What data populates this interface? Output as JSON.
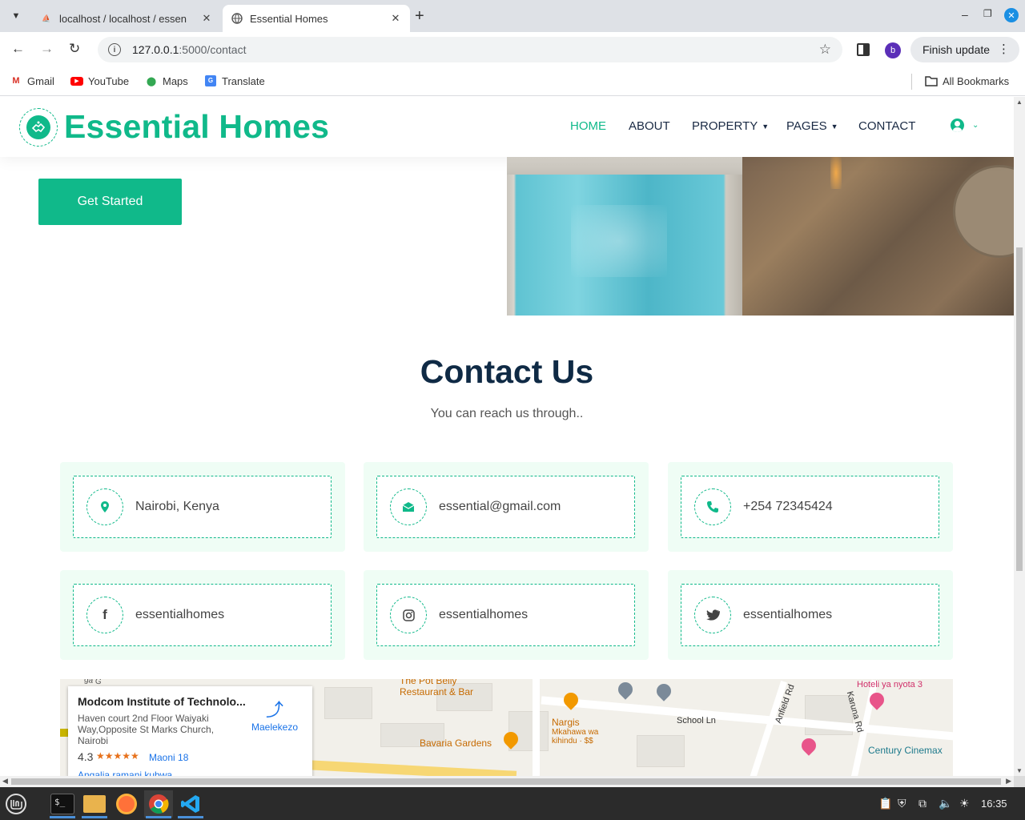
{
  "browser": {
    "tabs": [
      {
        "title": "localhost / localhost / essen",
        "favicon": "phpmyadmin-icon",
        "active": false
      },
      {
        "title": "Essential Homes",
        "favicon": "globe-icon",
        "active": true
      }
    ],
    "url_host": "127.0.0.1",
    "url_path": ":5000/contact",
    "profile_initial": "b",
    "finish_update": "Finish update",
    "bookmarks": [
      {
        "label": "Gmail",
        "icon": "gmail-icon"
      },
      {
        "label": "YouTube",
        "icon": "youtube-icon"
      },
      {
        "label": "Maps",
        "icon": "maps-icon"
      },
      {
        "label": "Translate",
        "icon": "translate-icon"
      }
    ],
    "all_bookmarks": "All Bookmarks"
  },
  "site": {
    "brand": "Essential Homes",
    "nav": [
      {
        "label": "HOME",
        "active": true,
        "dropdown": false
      },
      {
        "label": "ABOUT",
        "active": false,
        "dropdown": false
      },
      {
        "label": "PROPERTY",
        "active": false,
        "dropdown": true
      },
      {
        "label": "PAGES",
        "active": false,
        "dropdown": true
      },
      {
        "label": "CONTACT",
        "active": false,
        "dropdown": false
      }
    ],
    "accent_color": "#10b98a",
    "heading_color": "#0f2a45",
    "hero": {
      "cta": "Get Started"
    },
    "contact": {
      "title": "Contact Us",
      "subtitle": "You can reach us through..",
      "cards": [
        {
          "text": "Nairobi, Kenya",
          "icon": "location-pin-icon"
        },
        {
          "text": "essential@gmail.com",
          "icon": "envelope-icon"
        },
        {
          "text": "+254 72345424",
          "icon": "phone-icon"
        },
        {
          "text": "essentialhomes",
          "icon": "facebook-icon"
        },
        {
          "text": "essentialhomes",
          "icon": "instagram-icon"
        },
        {
          "text": "essentialhomes",
          "icon": "twitter-icon"
        }
      ]
    },
    "map": {
      "place_name": "Modcom Institute of Technolo...",
      "address": "Haven court 2nd Floor Waiyaki Way,Opposite St Marks Church, Nairobi",
      "rating": "4.3",
      "stars": "★★★★★",
      "reviews": "Maoni 18",
      "directions": "Maelekezo",
      "link": "Angalia ramani kubwa",
      "labels": {
        "pot_belly": "The Pot Belly\nRestaurant & Bar",
        "nargis": "Nargis",
        "nargis_sub": "Mkahawa wa\nkihindu · $$",
        "bavaria": "Bavaria Gardens",
        "school_ln": "School Ln",
        "anfield": "Anfield Rd",
        "karuna": "Karuna Rd",
        "hoteli": "Hoteli ya nyota 3",
        "century": "Century Cinemax",
        "ga": "ga G"
      }
    }
  },
  "taskbar": {
    "apps": [
      "mint-menu-icon",
      "terminal-icon",
      "files-icon",
      "firefox-icon",
      "chrome-icon",
      "vscode-icon"
    ],
    "clock": "16:35"
  }
}
